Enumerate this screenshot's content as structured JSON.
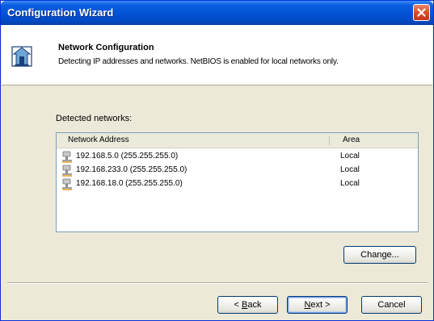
{
  "window": {
    "title": "Configuration Wizard"
  },
  "header": {
    "title": "Network Configuration",
    "description": "Detecting IP addresses and networks. NetBIOS is enabled for local networks only."
  },
  "networks": {
    "label": "Detected networks:",
    "columns": [
      "Network Address",
      "Area"
    ],
    "rows": [
      {
        "address": "192.168.5.0 (255.255.255.0)",
        "area": "Local"
      },
      {
        "address": "192.168.233.0 (255.255.255.0)",
        "area": "Local"
      },
      {
        "address": "192.168.18.0 (255.255.255.0)",
        "area": "Local"
      }
    ]
  },
  "buttons": {
    "change": "Change...",
    "back_mnemonic": "B",
    "back_rest": "ack",
    "back_prefix": "< ",
    "next_mnemonic": "N",
    "next_rest": "ext >",
    "cancel": "Cancel"
  },
  "icons": {
    "header": "network-config-icon",
    "row": "network-icon",
    "close": "close-icon"
  },
  "colors": {
    "titlebar": "#0453d8",
    "close": "#d8482a",
    "dialog_bg": "#ece9d8"
  }
}
